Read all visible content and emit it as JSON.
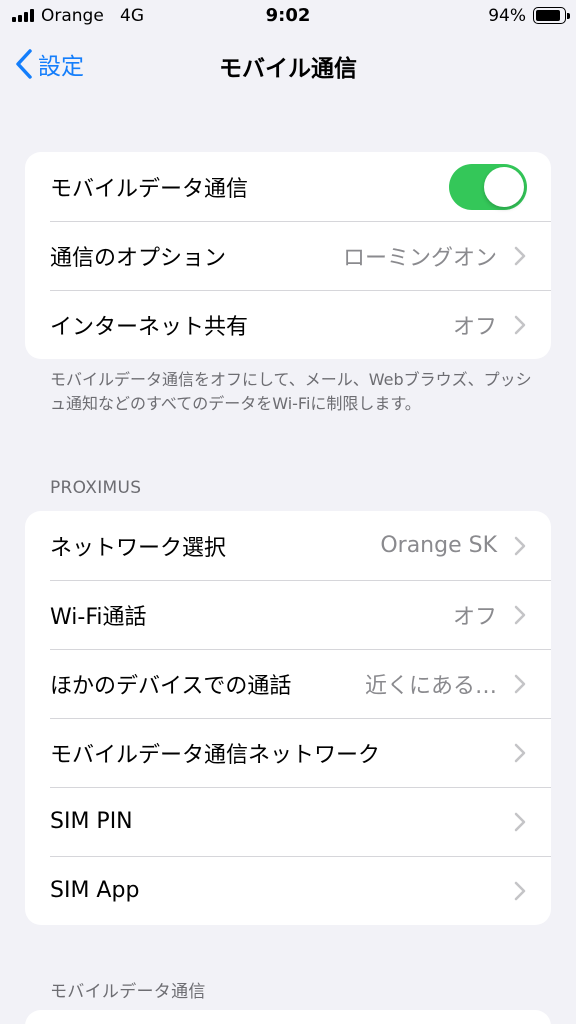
{
  "status_bar": {
    "carrier": "Orange",
    "network": "4G",
    "time": "9:02",
    "battery_percent": "94%",
    "battery_level": 0.94,
    "icons": [
      "cellular-signal-icon",
      "battery-icon"
    ]
  },
  "nav": {
    "back_label": "設定",
    "title": "モバイル通信",
    "accent_color": "#147efb"
  },
  "group1": {
    "rows": [
      {
        "label": "モバイルデータ通信",
        "toggle_on": true
      },
      {
        "label": "通信のオプション",
        "value": "ローミングオン"
      },
      {
        "label": "インターネット共有",
        "value": "オフ"
      }
    ]
  },
  "footer_note": "モバイルデータ通信をオフにして、メール、Webブラウズ、プッシュ通知などのすべてのデータをWi-Fiに制限します。",
  "section_proximus": {
    "header": "PROXIMUS",
    "rows": [
      {
        "label": "ネットワーク選択",
        "value": "Orange SK"
      },
      {
        "label": "Wi-Fi通話",
        "value": "オフ"
      },
      {
        "label": "ほかのデバイスでの通話",
        "value": "近くにある…"
      },
      {
        "label": "モバイルデータ通信ネットワーク",
        "value": ""
      },
      {
        "label": "SIM PIN",
        "value": ""
      },
      {
        "label": "SIM App",
        "value": ""
      }
    ]
  },
  "section_mobile_data": {
    "header": "モバイルデータ通信"
  },
  "colors": {
    "toggle_on": "#34c759",
    "background": "#f2f2f7",
    "secondary_text": "#8a8a8e"
  }
}
